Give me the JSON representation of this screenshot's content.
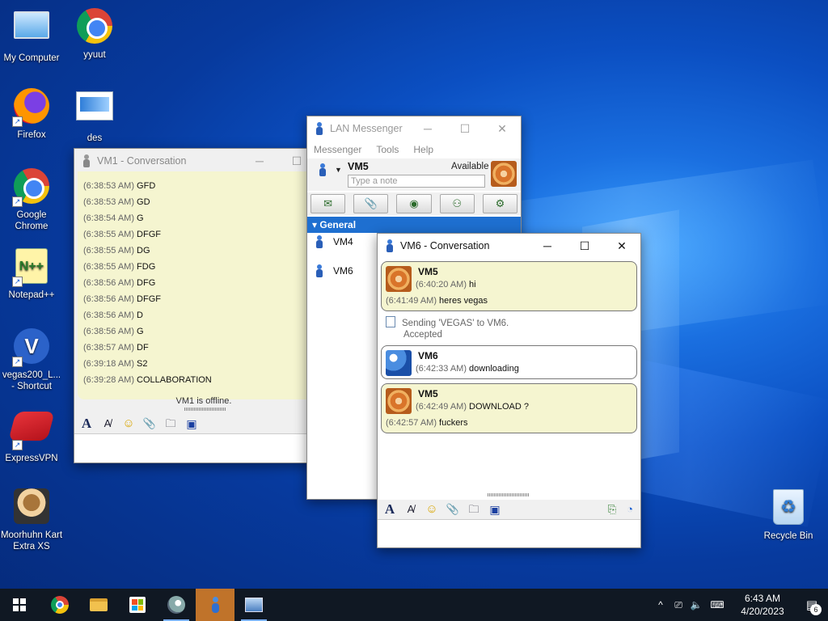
{
  "desktop": {
    "icons": [
      {
        "label": "My Computer"
      },
      {
        "label": "yyuut"
      },
      {
        "label": "Firefox"
      },
      {
        "label": "des"
      },
      {
        "label": "Google Chrome"
      },
      {
        "label": "Notepad++"
      },
      {
        "label": "vegas200_L... - Shortcut"
      },
      {
        "label": "ExpressVPN"
      },
      {
        "label": "Moorhuhn Kart Extra XS"
      },
      {
        "label": "Recycle Bin"
      }
    ]
  },
  "vm1_window": {
    "title": "VM1 - Conversation",
    "minimize": "─",
    "maximize": "☐",
    "messages": [
      {
        "time": "(6:38:53 AM)",
        "text": "GFD"
      },
      {
        "time": "(6:38:53 AM)",
        "text": "GD"
      },
      {
        "time": "(6:38:54 AM)",
        "text": "G"
      },
      {
        "time": "(6:38:55 AM)",
        "text": "DFGF"
      },
      {
        "time": "(6:38:55 AM)",
        "text": "DG"
      },
      {
        "time": "(6:38:55 AM)",
        "text": "FDG"
      },
      {
        "time": "(6:38:56 AM)",
        "text": "DFG"
      },
      {
        "time": "(6:38:56 AM)",
        "text": "DFGF"
      },
      {
        "time": "(6:38:56 AM)",
        "text": "D"
      },
      {
        "time": "(6:38:56 AM)",
        "text": "G"
      },
      {
        "time": "(6:38:57 AM)",
        "text": "DF"
      },
      {
        "time": "(6:39:18 AM)",
        "text": "S2"
      },
      {
        "time": "(6:39:28 AM)",
        "text": "COLLABORATION"
      }
    ],
    "status": "VM1 is offline."
  },
  "lan_messenger": {
    "title": "LAN Messenger",
    "minimize": "─",
    "maximize": "☐",
    "close": "✕",
    "menu": [
      "Messenger",
      "Tools",
      "Help"
    ],
    "user_name": "VM5",
    "user_status": "Available",
    "note_placeholder": "Type a note",
    "group_name": "General",
    "contacts": [
      {
        "name": "VM4"
      },
      {
        "name": "VM6"
      }
    ]
  },
  "vm6_window": {
    "title": "VM6 - Conversation",
    "minimize": "─",
    "maximize": "☐",
    "close": "✕",
    "bubbles": [
      {
        "sender": "VM5",
        "lines": [
          {
            "time": "(6:40:20 AM)",
            "text": "hi"
          },
          {
            "time": "(6:41:49 AM)",
            "text": "heres vegas"
          }
        ]
      },
      {
        "sender": "VM6",
        "lines": [
          {
            "time": "(6:42:33 AM)",
            "text": "downloading"
          }
        ]
      },
      {
        "sender": "VM5",
        "lines": [
          {
            "time": "(6:42:49 AM)",
            "text": "DOWNLOAD ?"
          },
          {
            "time": "(6:42:57 AM)",
            "text": "fuckers"
          }
        ]
      }
    ],
    "system_message": {
      "line1": "Sending 'VEGAS' to VM6.",
      "line2": "Accepted"
    }
  },
  "taskbar": {
    "clock_time": "6:43 AM",
    "clock_date": "4/20/2023",
    "notification_count": "6"
  }
}
